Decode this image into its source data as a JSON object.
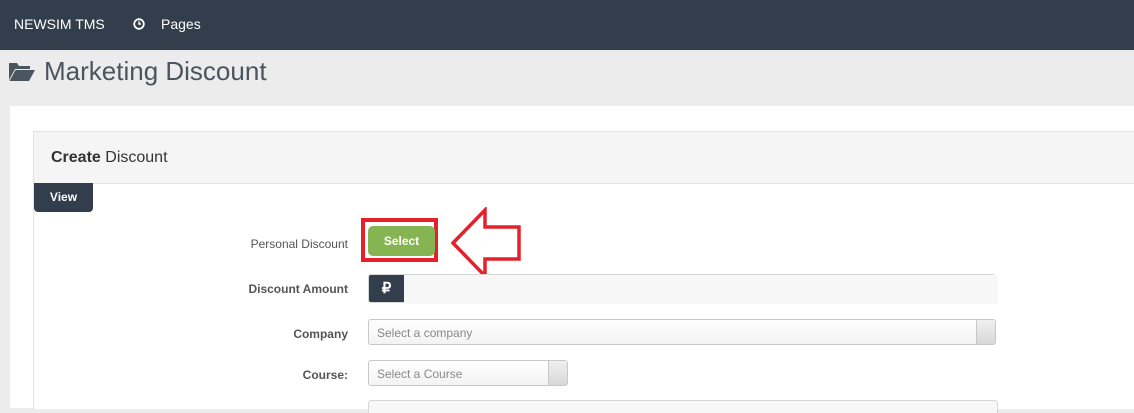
{
  "navbar": {
    "brand": "NEWSIM TMS",
    "pages_label": "Pages",
    "pages_icon": "clock-icon"
  },
  "page": {
    "title": "Marketing Discount",
    "title_icon": "folder-open-icon"
  },
  "panel": {
    "title_bold": "Create",
    "title_rest": " Discount",
    "view_label": "View"
  },
  "form": {
    "personal_discount": {
      "label": "Personal Discount",
      "button_label": "Select"
    },
    "discount_amount": {
      "label": "Discount Amount",
      "currency_symbol": "₽",
      "value": ""
    },
    "company": {
      "label": "Company",
      "placeholder": "Select a company"
    },
    "course": {
      "label": "Course:",
      "placeholder": "Select a Course"
    }
  },
  "colors": {
    "navbar": "#323e4b",
    "select_button": "#87b453",
    "annotation": "#e3202b"
  }
}
